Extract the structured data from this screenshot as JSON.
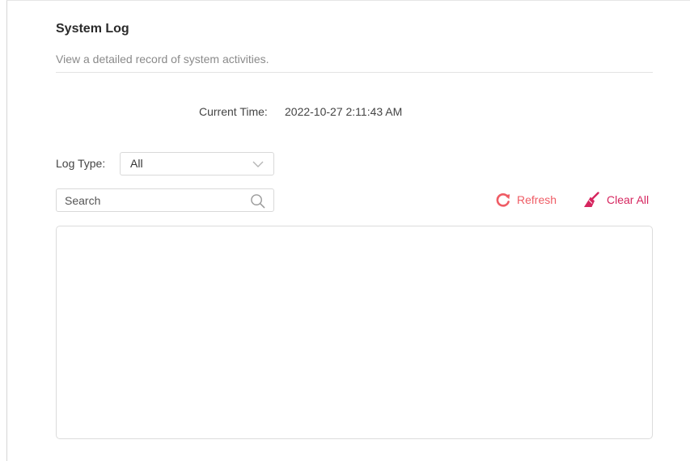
{
  "header": {
    "title": "System Log",
    "description": "View a detailed record of system activities."
  },
  "current_time": {
    "label": "Current Time:",
    "value": "2022-10-27 2:11:43 AM"
  },
  "log_type": {
    "label": "Log Type:",
    "selected": "All",
    "icon": "chevron-down-icon"
  },
  "search": {
    "placeholder": "Search",
    "icon": "search-icon"
  },
  "actions": {
    "refresh_label": "Refresh",
    "refresh_icon": "refresh-icon",
    "clear_label": "Clear All",
    "clear_icon": "broom-icon"
  },
  "log": {
    "entries": []
  },
  "colors": {
    "refresh": "#ef5c65",
    "clear_all": "#d6265f",
    "border": "#d9d9d9"
  }
}
